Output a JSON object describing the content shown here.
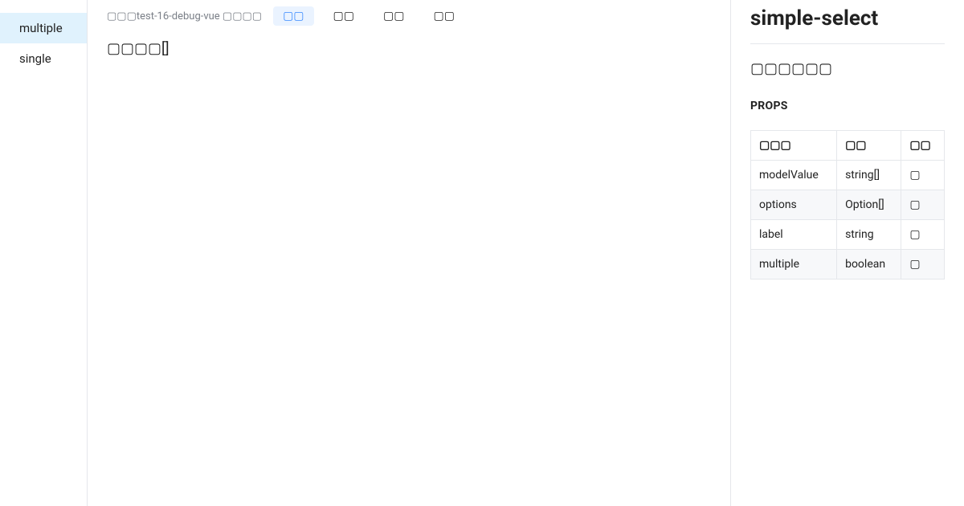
{
  "sidebar": {
    "items": [
      {
        "label": "multiple",
        "active": true
      },
      {
        "label": "single",
        "active": false
      }
    ]
  },
  "main": {
    "breadcrumb": "▢▢▢test-16-debug-vue ▢▢▢▢",
    "tabs": [
      {
        "label": "▢▢",
        "active": true
      },
      {
        "label": "▢▢",
        "active": false
      },
      {
        "label": "▢▢",
        "active": false
      },
      {
        "label": "▢▢",
        "active": false
      }
    ],
    "result_prefix": "▢▢▢▢",
    "result_value": "[]"
  },
  "right": {
    "title": "simple-select",
    "subtitle": "▢▢▢▢▢▢",
    "props_heading": "PROPS",
    "table": {
      "headers": [
        "▢▢▢",
        "▢▢",
        "▢▢"
      ],
      "rows": [
        {
          "name": "modelValue",
          "type": "string[]",
          "note": "▢"
        },
        {
          "name": "options",
          "type": "Option[]",
          "note": "▢"
        },
        {
          "name": "label",
          "type": "string",
          "note": "▢"
        },
        {
          "name": "multiple",
          "type": "boolean",
          "note": "▢"
        }
      ]
    }
  }
}
